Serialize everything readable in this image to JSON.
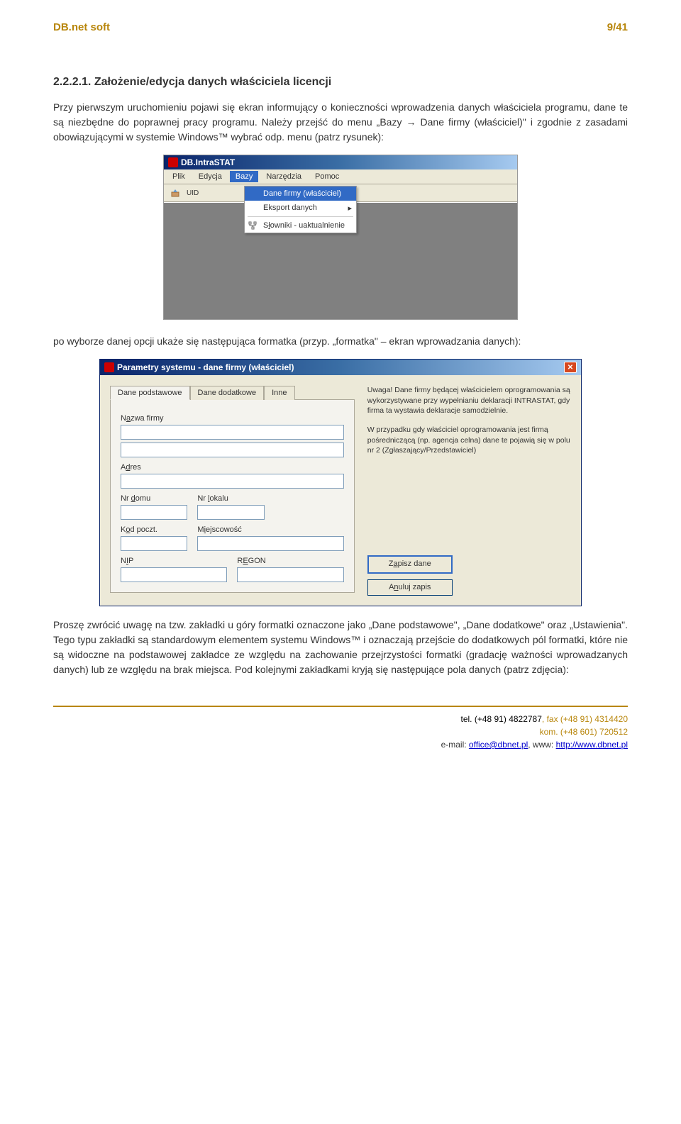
{
  "header": {
    "brand": "DB.net soft",
    "page_indicator": "9/41"
  },
  "section": {
    "number": "2.2.2.1.",
    "title": "Założenie/edycja danych właściciela licencji",
    "p1": "Przy pierwszym uruchomieniu pojawi się ekran informujący o konieczności wprowadzenia danych właściciela programu, dane te są niezbędne do poprawnej pracy programu. Należy przejść do menu „Bazy → Dane firmy (właściciel)\" i zgodnie z zasadami obowiązującymi w systemie Windows™ wybrać odp. menu (patrz rysunek):",
    "p2": "po wyborze danej opcji ukaże się następująca formatka (przyp. „formatka\" – ekran wprowadzania danych):",
    "p3": "Proszę zwrócić uwagę na tzw. zakładki u góry formatki oznaczone jako „Dane podstawowe\", „Dane dodatkowe\" oraz „Ustawienia\". Tego typu zakładki są standardowym elementem systemu Windows™ i oznaczają przejście do dodatkowych pól formatki, które nie są widoczne na podstawowej zakładce ze względu na zachowanie przejrzystości formatki (gradację ważności wprowadzanych danych) lub ze względu na brak miejsca. Pod kolejnymi zakładkami kryją się następujące pola danych (patrz zdjęcia):"
  },
  "ss1": {
    "title": "DB.IntraSTAT",
    "menu": {
      "plik": "Plik",
      "edycja": "Edycja",
      "bazy": "Bazy",
      "narzedzia": "Narzędzia",
      "pomoc": "Pomoc"
    },
    "dropdown": {
      "item1": "Dane firmy (właściciel)",
      "item2": "Eksport danych",
      "item3_prefix": "S",
      "item3_ul": "ł",
      "item3_suffix": "owniki - uaktualnienie"
    },
    "uid_label": "UID"
  },
  "ss2": {
    "title": "Parametry systemu - dane firmy (właściciel)",
    "tabs": {
      "t1": "Dane podstawowe",
      "t2": "Dane dodatkowe",
      "t3": "Inne"
    },
    "labels": {
      "nazwa_prefix": "N",
      "nazwa_ul": "a",
      "nazwa_suffix": "zwa firmy",
      "adres_prefix": "A",
      "adres_ul": "d",
      "adres_suffix": "res",
      "nrdomu_prefix": "Nr ",
      "nrdomu_ul": "d",
      "nrdomu_suffix": "omu",
      "nrlokalu_prefix": "Nr ",
      "nrlokalu_ul": "l",
      "nrlokalu_suffix": "okalu",
      "kod_prefix": "K",
      "kod_ul": "o",
      "kod_suffix": "d poczt.",
      "miejsc_prefix": "M",
      "miejsc_ul": "i",
      "miejsc_suffix": "ejscowość",
      "nip_prefix": "N",
      "nip_ul": "I",
      "nip_suffix": "P",
      "regon_prefix": "R",
      "regon_ul": "E",
      "regon_suffix": "GON"
    },
    "info": {
      "p1": "Uwaga! Dane firmy będącej właścicielem oprogramowania są wykorzystywane przy wypełnianiu deklaracji INTRASTAT, gdy firma ta wystawia deklaracje samodzielnie.",
      "p2": "W przypadku gdy właściciel oprogramowania jest firmą pośredniczącą (np. agencja celna) dane te pojawią się w polu nr 2 (Zgłaszający/Przedstawiciel)"
    },
    "buttons": {
      "zapisz_prefix": "Z",
      "zapisz_ul": "a",
      "zapisz_suffix": "pisz dane",
      "anuluj_prefix": "A",
      "anuluj_ul": "n",
      "anuluj_suffix": "uluj zapis"
    }
  },
  "footer": {
    "line1_left": "tel. (+48 91) 4822787",
    "line1_right": ", fax (+48 91) 4314420",
    "line2": "kom. (+48 601) 720512",
    "line3_left": "e-mail: ",
    "email": "office@dbnet.pl",
    "line3_mid": ", www: ",
    "www": "http://www.dbnet.pl"
  }
}
